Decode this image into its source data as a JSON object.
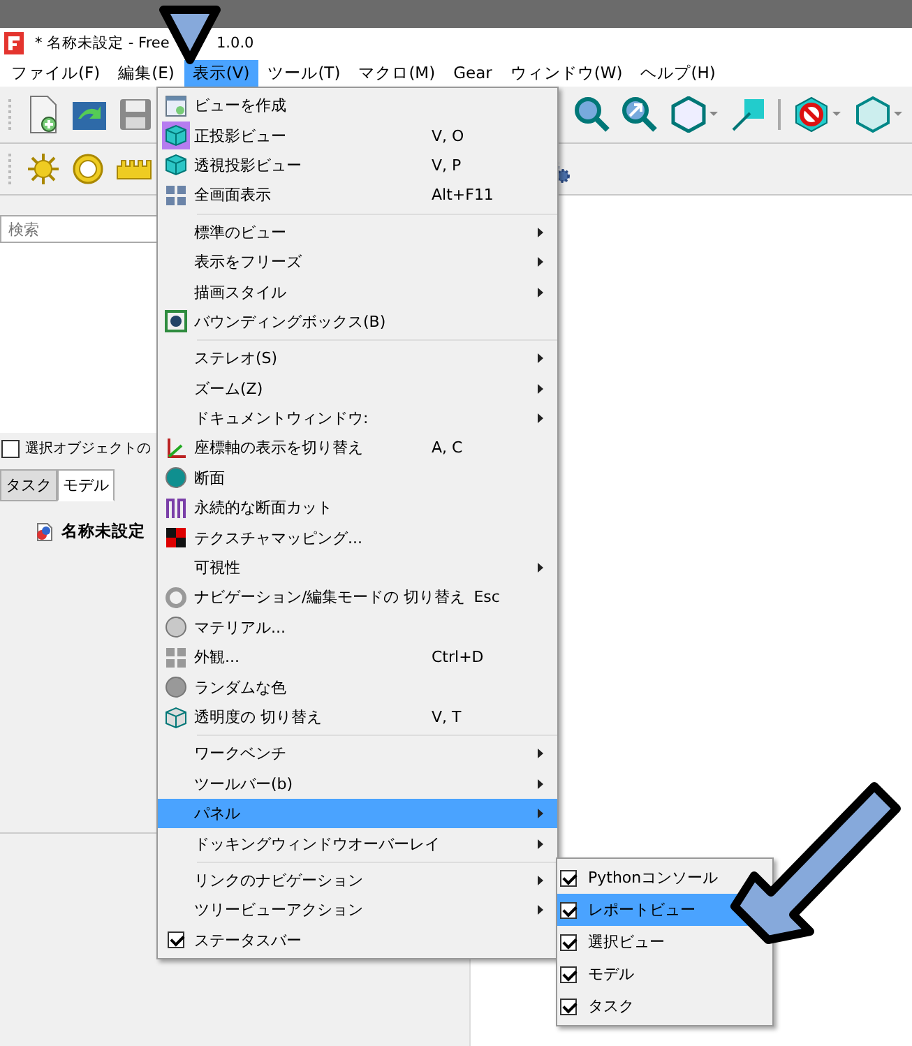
{
  "window": {
    "title_start": "* 名称未設定 - Free",
    "title_end": "1.0.0"
  },
  "menubar": [
    {
      "label": "ファイル(F)",
      "selected": false
    },
    {
      "label": "編集(E)",
      "selected": false
    },
    {
      "label": "表示(V)",
      "selected": true
    },
    {
      "label": "ツール(T)",
      "selected": false
    },
    {
      "label": "マクロ(M)",
      "selected": false
    },
    {
      "label": "Gear",
      "selected": false
    },
    {
      "label": "ウィンドウ(W)",
      "selected": false
    },
    {
      "label": "ヘルプ(H)",
      "selected": false
    }
  ],
  "left_panel": {
    "search": {
      "placeholder": "検索"
    },
    "sync_option": {
      "label": "選択オブジェクトの",
      "checked": false
    },
    "tabs": [
      {
        "label": "タスク",
        "selected": false
      },
      {
        "label": "モデル",
        "selected": true
      }
    ],
    "tree": [
      {
        "label": "名称未設定"
      }
    ]
  },
  "view_menu": [
    {
      "kind": "icon",
      "label": "ビューを作成",
      "selected": false,
      "submenu": false
    },
    {
      "kind": "icon",
      "label": "正投影ビュー",
      "shortcut": "V, O",
      "checked": true,
      "selected": false,
      "submenu": false
    },
    {
      "kind": "icon",
      "label": "透視投影ビュー",
      "shortcut": "V, P",
      "checked": false,
      "selected": false,
      "submenu": false
    },
    {
      "kind": "icon",
      "label": "全画面表示",
      "shortcut": "Alt+F11",
      "selected": false,
      "submenu": false
    },
    {
      "kind": "separator"
    },
    {
      "kind": "plain",
      "label": "標準のビュー",
      "selected": false,
      "submenu": true
    },
    {
      "kind": "plain",
      "label": "表示をフリーズ",
      "selected": false,
      "submenu": true
    },
    {
      "kind": "plain",
      "label": "描画スタイル",
      "selected": false,
      "submenu": true
    },
    {
      "kind": "icon",
      "label": "バウンディングボックス(B)",
      "selected": false,
      "submenu": false
    },
    {
      "kind": "separator"
    },
    {
      "kind": "plain",
      "label": "ステレオ(S)",
      "selected": false,
      "submenu": true
    },
    {
      "kind": "plain",
      "label": "ズーム(Z)",
      "selected": false,
      "submenu": true
    },
    {
      "kind": "plain",
      "label": "ドキュメントウィンドウ:",
      "selected": false,
      "submenu": true
    },
    {
      "kind": "icon",
      "label": "座標軸の表示を切り替え",
      "shortcut": "A, C",
      "selected": false,
      "submenu": false
    },
    {
      "kind": "icon",
      "label": "断面",
      "selected": false,
      "submenu": false
    },
    {
      "kind": "icon",
      "label": "永続的な断面カット",
      "selected": false,
      "submenu": false
    },
    {
      "kind": "icon",
      "label": "テクスチャマッピング...",
      "selected": false,
      "submenu": false
    },
    {
      "kind": "plain",
      "label": "可視性",
      "selected": false,
      "submenu": true
    },
    {
      "kind": "icon",
      "label": "ナビゲーション/編集モードの 切り替え",
      "shortcut": "Esc",
      "selected": false,
      "submenu": false
    },
    {
      "kind": "icon",
      "label": "マテリアル...",
      "selected": false,
      "submenu": false
    },
    {
      "kind": "icon",
      "label": "外観...",
      "shortcut": "Ctrl+D",
      "selected": false,
      "submenu": false
    },
    {
      "kind": "icon",
      "label": "ランダムな色",
      "selected": false,
      "submenu": false
    },
    {
      "kind": "icon",
      "label": "透明度の 切り替え",
      "shortcut": "V, T",
      "selected": false,
      "submenu": false
    },
    {
      "kind": "separator"
    },
    {
      "kind": "plain",
      "label": "ワークベンチ",
      "selected": false,
      "submenu": true
    },
    {
      "kind": "plain",
      "label": "ツールバー(b)",
      "selected": false,
      "submenu": true
    },
    {
      "kind": "plain",
      "label": "パネル",
      "selected": true,
      "submenu": true
    },
    {
      "kind": "plain",
      "label": "ドッキングウィンドウオーバーレイ",
      "selected": false,
      "submenu": true
    },
    {
      "kind": "separator"
    },
    {
      "kind": "plain",
      "label": "リンクのナビゲーション",
      "selected": false,
      "submenu": true
    },
    {
      "kind": "plain",
      "label": "ツリービューアクション",
      "selected": false,
      "submenu": true
    },
    {
      "kind": "check",
      "label": "ステータスバー",
      "checked": true,
      "selected": false,
      "submenu": false
    }
  ],
  "panels_submenu": [
    {
      "label": "Pythonコンソール",
      "checked": true,
      "selected": false
    },
    {
      "label": "レポートビュー",
      "checked": true,
      "selected": true
    },
    {
      "label": "選択ビュー",
      "checked": true,
      "selected": false
    },
    {
      "label": "モデル",
      "checked": true,
      "selected": false
    },
    {
      "label": "タスク",
      "checked": true,
      "selected": false
    }
  ]
}
